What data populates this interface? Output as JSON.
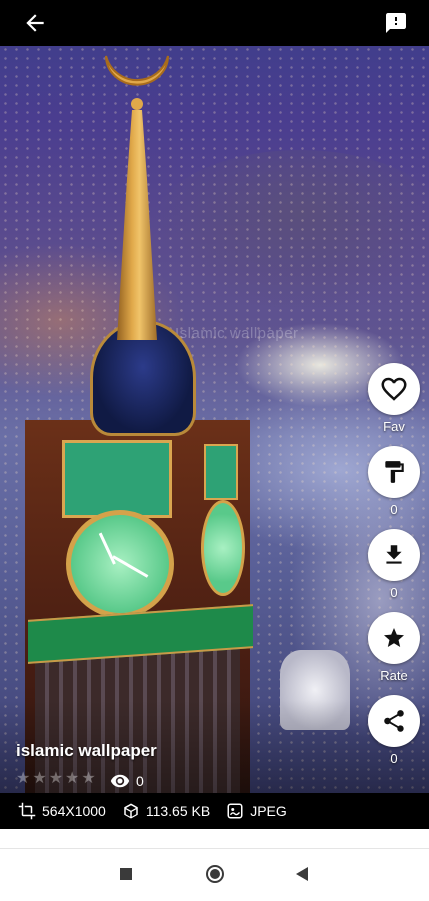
{
  "wallpaper": {
    "title": "islamic wallpaper",
    "watermark": "Islamic wallpaper",
    "rating": 0,
    "views": "0",
    "resolution": "564X1000",
    "file_size": "113.65 KB",
    "format": "JPEG"
  },
  "actions": {
    "fav_label": "Fav",
    "set_count": "0",
    "download_count": "0",
    "rate_label": "Rate",
    "share_count": "0"
  },
  "icons": {
    "back": "arrow-left-icon",
    "report": "report-icon",
    "fav": "heart-icon",
    "set": "paint-roller-icon",
    "download": "download-icon",
    "rate": "star-icon",
    "share": "share-icon",
    "resolution": "crop-icon",
    "size": "cube-icon",
    "format": "image-icon",
    "views": "eye-icon"
  },
  "colors": {
    "accent": "#ffffff",
    "topbar": "#000000",
    "navbar": "#ffffff"
  }
}
